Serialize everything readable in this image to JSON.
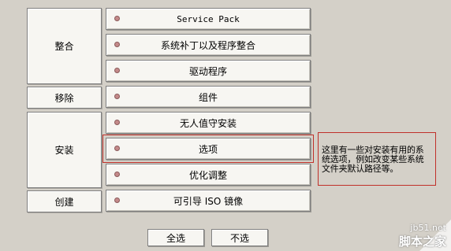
{
  "groups": {
    "integration": "整合",
    "remove": "移除",
    "install": "安装",
    "create": "创建"
  },
  "items": [
    {
      "label": "Service Pack"
    },
    {
      "label": "系统补丁以及程序整合"
    },
    {
      "label": "驱动程序"
    },
    {
      "label": "组件"
    },
    {
      "label": "无人值守安装"
    },
    {
      "label": "选项"
    },
    {
      "label": "优化调整"
    },
    {
      "label": "可引导 ISO 镜像"
    }
  ],
  "description": "这里有一些对安装有用的系统选项，例如改变某些系统文件夹默认路径等。",
  "buttons": {
    "select_all": "全选",
    "select_none": "不选"
  },
  "watermark": {
    "site": "jb51.net",
    "brand": "脚本之家"
  },
  "colors": {
    "background": "#d4d0c8",
    "highlight_border": "#c0302a",
    "bullet": "#c48a8a"
  }
}
